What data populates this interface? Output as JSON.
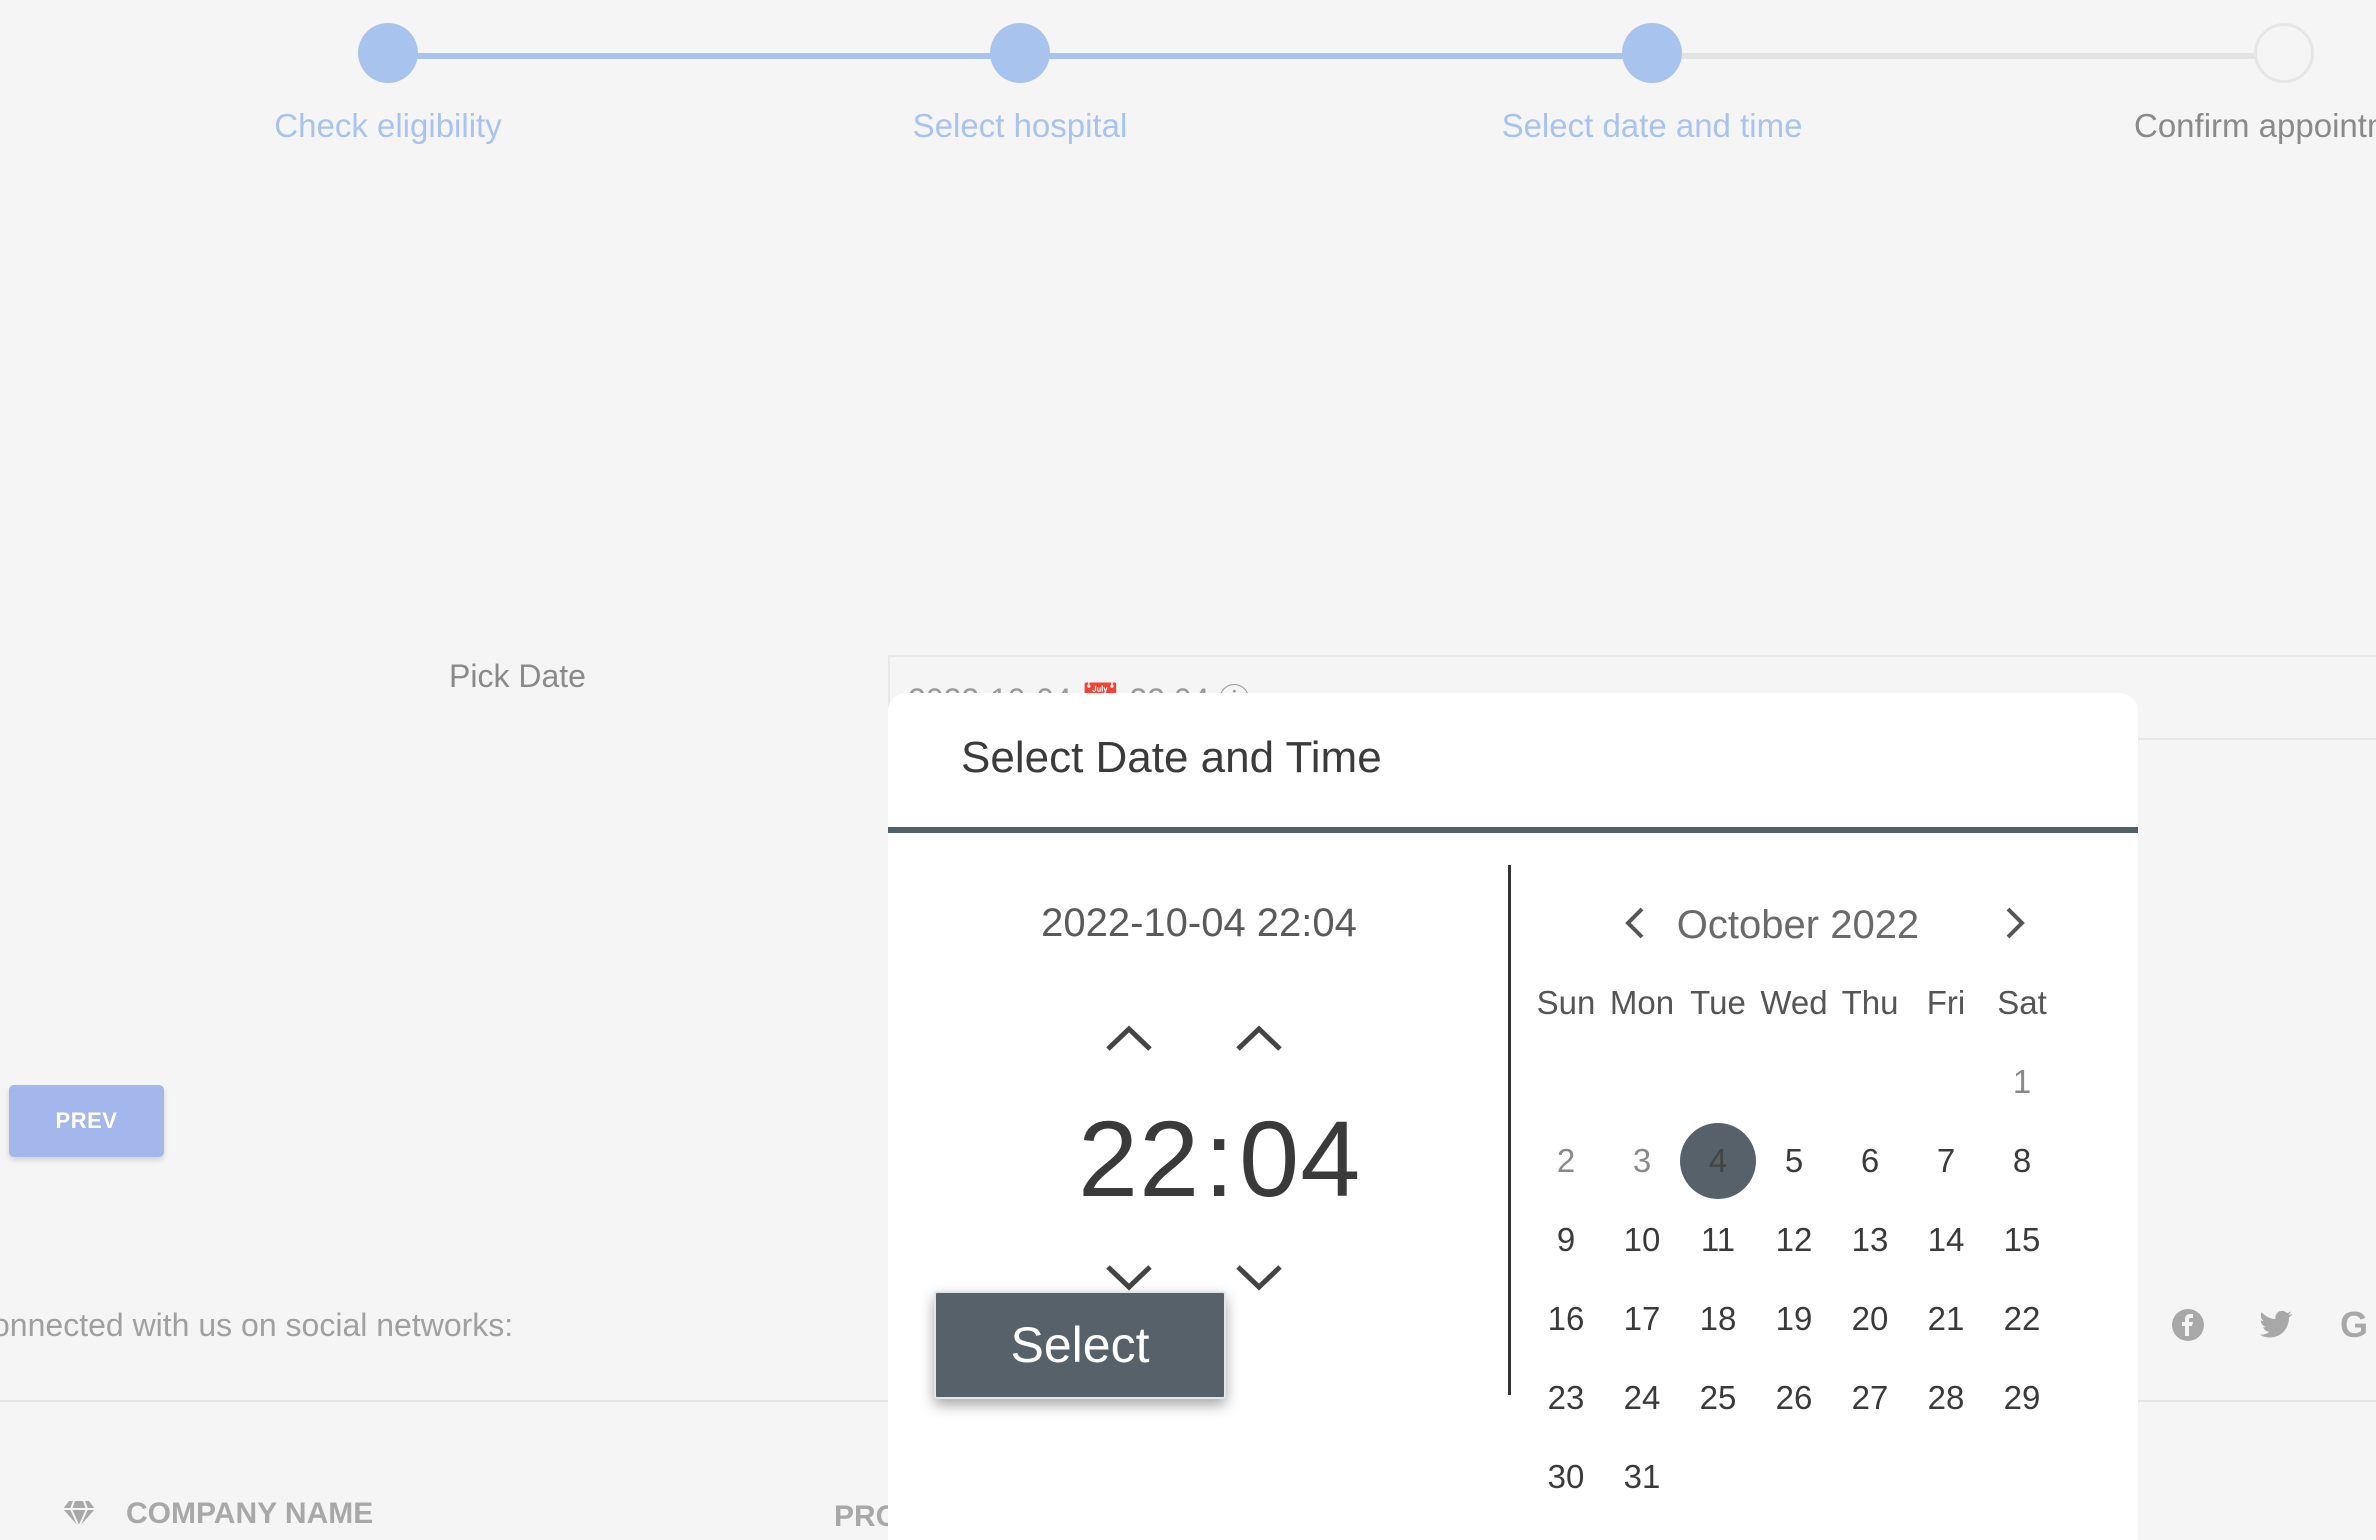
{
  "stepper": {
    "steps": [
      {
        "label": "Check eligibility",
        "state": "done"
      },
      {
        "label": "Select hospital",
        "state": "done"
      },
      {
        "label": "Select date and time",
        "state": "done"
      },
      {
        "label": "Confirm appointm",
        "state": "todo"
      }
    ]
  },
  "form": {
    "pick_date_label": "Pick Date",
    "date_input_value": "2022-10-04 📅 22:04 ⓘ"
  },
  "nav": {
    "prev_label": "PREV"
  },
  "footer": {
    "social_text": "onnected with us on social networks:",
    "social_icons": [
      "facebook-icon",
      "twitter-icon",
      "google-icon"
    ],
    "company_name": "COMPANY NAME",
    "products_label": "PRO"
  },
  "modal": {
    "title": "Select Date and Time",
    "current_datetime": "2022-10-04 22:04",
    "hour": "22",
    "separator": ":",
    "minute": "04",
    "select_label": "Select",
    "calendar": {
      "month_label": "October 2022",
      "weekdays": [
        "Sun",
        "Mon",
        "Tue",
        "Wed",
        "Thu",
        "Fri",
        "Sat"
      ],
      "leading_blanks": 6,
      "days": [
        "1",
        "2",
        "3",
        "4",
        "5",
        "6",
        "7",
        "8",
        "9",
        "10",
        "11",
        "12",
        "13",
        "14",
        "15",
        "16",
        "17",
        "18",
        "19",
        "20",
        "21",
        "22",
        "23",
        "24",
        "25",
        "26",
        "27",
        "28",
        "29",
        "30",
        "31"
      ],
      "selected_day": "4",
      "muted_days": [
        "1",
        "2",
        "3"
      ]
    }
  },
  "colors": {
    "accent": "#a8c4ee",
    "modal_dark": "#566169",
    "prev_button": "#a3b7ec"
  }
}
